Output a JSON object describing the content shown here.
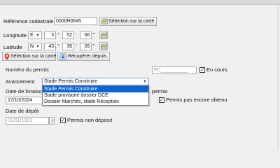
{
  "cadastre": {
    "label": "Référence cadastrale",
    "value": "0000H0645",
    "map_button": "Sélection sur la carte"
  },
  "longitude": {
    "label": "Longitude",
    "dir": "E",
    "deg": "3",
    "min": "52",
    "sec": "36"
  },
  "latitude": {
    "label": "Latitude",
    "dir": "N",
    "deg": "43",
    "min": "36",
    "sec": "39"
  },
  "symbols": {
    "deg": "°",
    "min": "'",
    "sec": "\""
  },
  "coord_buttons": {
    "map": "Sélection sur la carte",
    "retrieve": "Récupérer depuis"
  },
  "permis": {
    "numero_label": "Numéro du permis",
    "numero_value": "PC__________",
    "en_cours_label": "En cours",
    "avancement_label": "Avancement",
    "avancement_value": "Stade Permis Construire",
    "options": [
      "Stade Permis Construire",
      "Stade provisoire dossier DCE",
      "Dossier Marchés, stade Réception"
    ],
    "livraison_label": "Date de livraison",
    "livraison_value": "17/10/2024",
    "permis_suffix": "permis",
    "pas_obtenu_label": "Permis pas encore obtenu",
    "depot_label": "Date de dépôt",
    "depot_value": "01/01/1901",
    "non_depose_label": "Permis non déposé"
  },
  "checked_mark": "✓",
  "colors": {
    "accent": "#0a64d8",
    "pin": "#d93025",
    "window": "#f0f0f0"
  },
  "icons": [
    "map-pin-icon",
    "map-icon",
    "download-icon",
    "calendar-icon",
    "checkbox-icon"
  ]
}
